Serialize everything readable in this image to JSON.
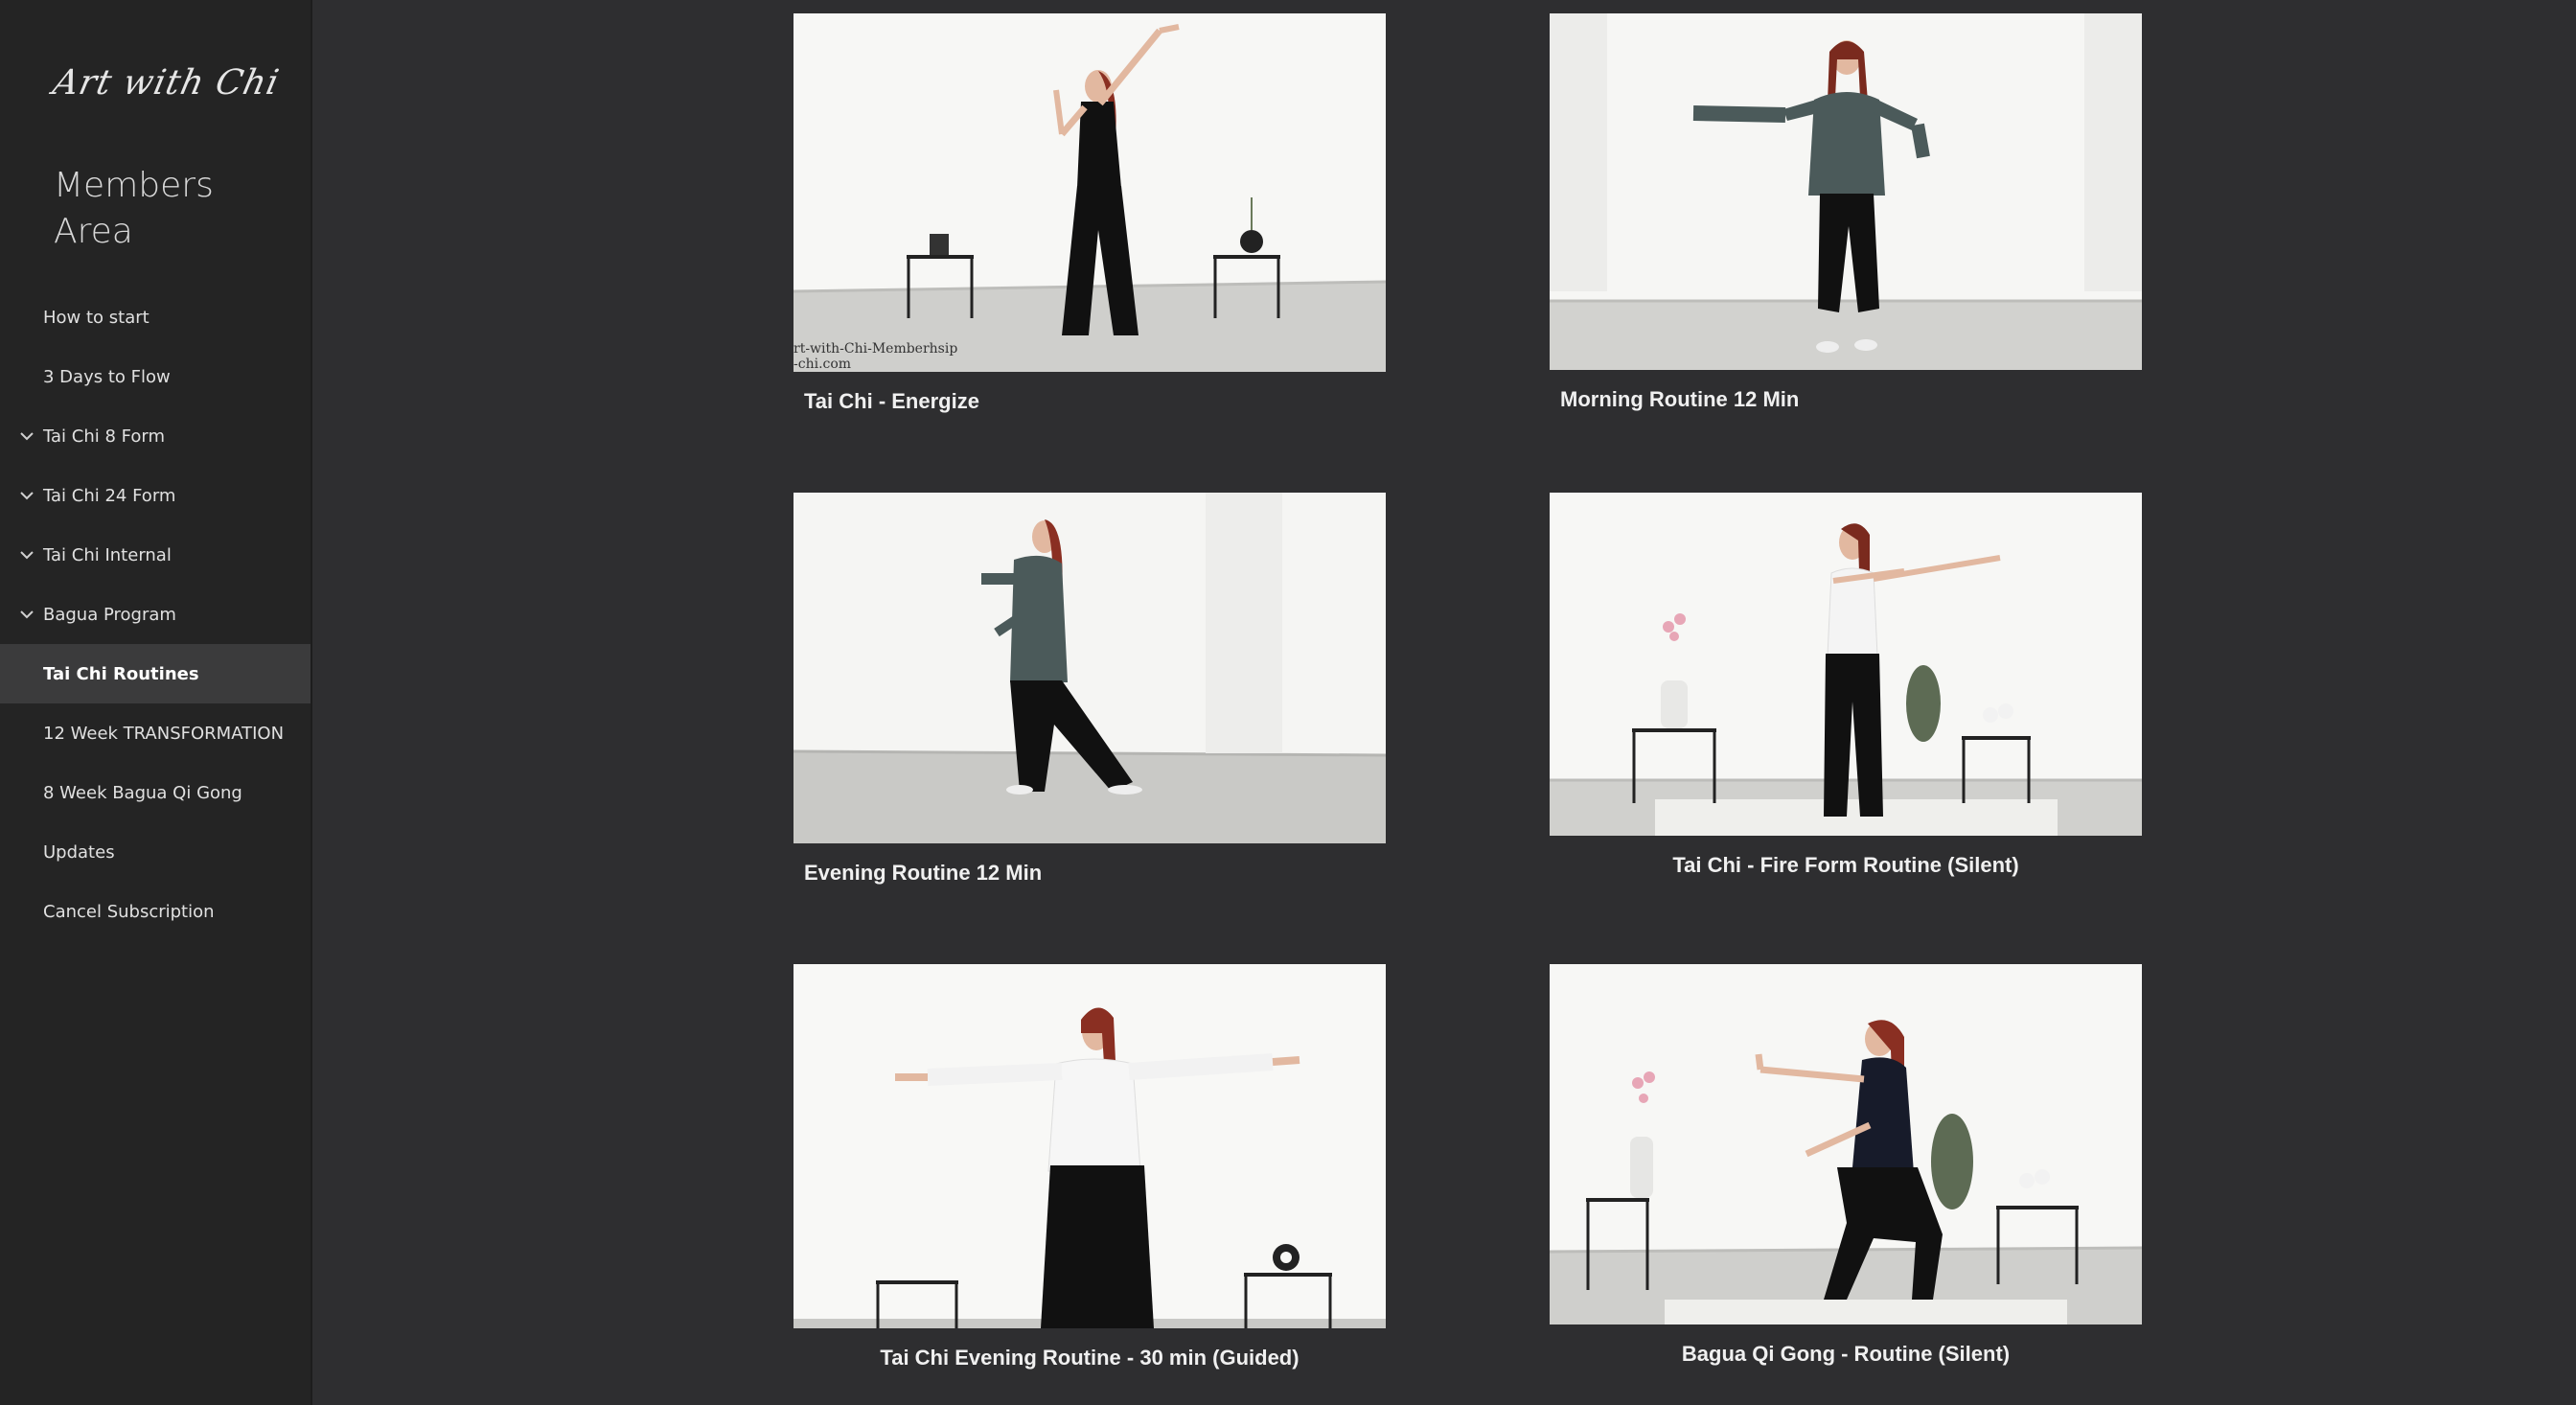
{
  "brand": {
    "logo_text": "Art with Chi"
  },
  "sidebar": {
    "title": "Members Area",
    "items": [
      {
        "label": "How to start",
        "expandable": false,
        "active": false
      },
      {
        "label": "3 Days to Flow",
        "expandable": false,
        "active": false
      },
      {
        "label": "Tai Chi 8 Form",
        "expandable": true,
        "active": false
      },
      {
        "label": "Tai Chi 24 Form",
        "expandable": true,
        "active": false
      },
      {
        "label": "Tai Chi Internal",
        "expandable": true,
        "active": false
      },
      {
        "label": "Bagua Program",
        "expandable": true,
        "active": false
      },
      {
        "label": "Tai Chi Routines",
        "expandable": false,
        "active": true
      },
      {
        "label": "12 Week TRANSFORMATION",
        "expandable": false,
        "active": false
      },
      {
        "label": "8 Week Bagua Qi Gong",
        "expandable": false,
        "active": false
      },
      {
        "label": "Updates",
        "expandable": false,
        "active": false
      },
      {
        "label": "Cancel Subscription",
        "expandable": false,
        "active": false
      }
    ]
  },
  "videos": [
    {
      "title": "Tai Chi - Energize",
      "watermark": "rt-with-Chi-Memberhsip\n-chi.com"
    },
    {
      "title": "Morning Routine 12 Min"
    },
    {
      "title": "Evening Routine 12 Min"
    },
    {
      "title": "Tai Chi - Fire Form Routine (Silent)"
    },
    {
      "title": "Tai Chi Evening Routine - 30 min (Guided)"
    },
    {
      "title": "Bagua Qi Gong - Routine (Silent)"
    }
  ],
  "colors": {
    "page_bg": "#2e2e30",
    "sidebar_bg": "#242424",
    "active_item_bg": "#3b3b3c",
    "text": "#e0e0e0"
  }
}
